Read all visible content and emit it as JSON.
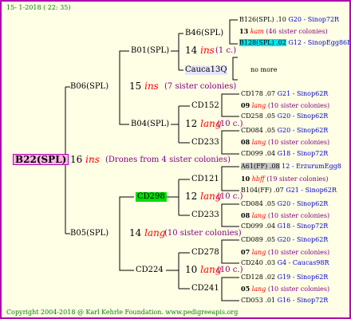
{
  "timestamp": "15- 1-2018 ( 22: 35)",
  "footer": "Copyright 2004-2018 @ Karl Kehrle Foundation.   www.pedigreeapis.org",
  "root": {
    "name": "B22(SPL)",
    "num": "16",
    "ins": "ins",
    "note": "(Drones from 4 sister colonies)"
  },
  "gen1": [
    {
      "name": "B06(SPL)",
      "num": "15",
      "ins": "ins",
      "note": "(7 sister colonies)"
    },
    {
      "name": "B05(SPL)",
      "num": "14",
      "ins": "lang",
      "note": "(10 sister colonies)"
    }
  ],
  "gen2": [
    {
      "name": "B01(SPL)",
      "num": "14",
      "ins": "ins",
      "note": "(1 c.)"
    },
    {
      "name": "B04(SPL)",
      "num": "12",
      "ins": "lang",
      "note": "(10 c.)"
    },
    {
      "name": "CD298",
      "num": "12",
      "ins": "lang",
      "note": "(10 c.)"
    },
    {
      "name": "CD224",
      "num": "10",
      "ins": "lang",
      "note": "(10 c.)"
    }
  ],
  "gen3": [
    "B46(SPL)",
    "Cauca13Q",
    "CD152",
    "CD233",
    "CD121",
    "CD233",
    "CD278",
    "CD241"
  ],
  "gen4": [
    {
      "text": "B126(SPL) .10",
      "suffix": "G20 - Sinop72R"
    },
    {
      "num": "13",
      "ins": "kam",
      "note": "(46 sister colonies)"
    },
    {
      "text": "B128(SPL) .02",
      "suffix": "G12 - SinopEgg86R"
    },
    {
      "text": "no more"
    },
    {
      "text": "CD178 .07",
      "suffix": "G21 - Sinop62R"
    },
    {
      "num": "09",
      "ins": "lang",
      "note": "(10 sister colonies)"
    },
    {
      "text": "CD258 .05",
      "suffix": "G20 - Sinop62R"
    },
    {
      "text": "CD084 .05",
      "suffix": "G20 - Sinop62R"
    },
    {
      "num": "08",
      "ins": "lang",
      "note": "(10 sister colonies)"
    },
    {
      "text": "CD099 .04",
      "suffix": "G18 - Sinop72R"
    },
    {
      "text": "A61(FF) .08",
      "suffix": "12 - ErzurumEgg8"
    },
    {
      "num": "10",
      "ins": "hbff",
      "note": "(19 sister colonies)"
    },
    {
      "text": "B104(FF) .07",
      "suffix": "G21 - Sinop62R"
    },
    {
      "text": "CD084 .05",
      "suffix": "G20 - Sinop62R"
    },
    {
      "num": "08",
      "ins": "lang",
      "note": "(10 sister colonies)"
    },
    {
      "text": "CD099 .04",
      "suffix": "G18 - Sinop72R"
    },
    {
      "text": "CD089 .05",
      "suffix": "G20 - Sinop62R"
    },
    {
      "num": "07",
      "ins": "lang",
      "note": "(10 sister colonies)"
    },
    {
      "text": "CD240 .03",
      "suffix": "G4 - Caucas98R"
    },
    {
      "text": "CD128 .02",
      "suffix": "G19 - Sinop62R"
    },
    {
      "num": "05",
      "ins": "lang",
      "note": "(10 sister colonies)"
    },
    {
      "text": "CD053 .01",
      "suffix": "G16 - Sinop72R"
    }
  ]
}
